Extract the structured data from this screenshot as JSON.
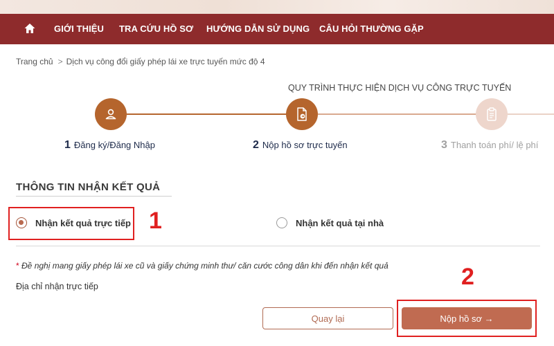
{
  "colors": {
    "brand": "#8e2b2c",
    "accent": "#c06b51",
    "step_active": "#b5652d",
    "step_inactive": "#eed6cc",
    "annotation": "#e02020"
  },
  "nav": {
    "home_icon": "home-icon",
    "items": [
      "GIỚI THIỆU",
      "TRA CỨU HỒ SƠ",
      "HƯỚNG DẪN SỬ DỤNG",
      "CÂU HỎI THƯỜNG GẶP"
    ]
  },
  "breadcrumb": {
    "home": "Trang chủ",
    "separator": ">",
    "current": "Dịch vụ công đổi giấy phép lái xe trực tuyến mức độ 4"
  },
  "process": {
    "title": "QUY TRÌNH THỰC HIỆN DỊCH VỤ CÔNG TRỰC TUYẾN",
    "steps": [
      {
        "number": "1",
        "label": "Đăng ký/Đăng Nhập",
        "icon": "user-icon",
        "state": "done"
      },
      {
        "number": "2",
        "label": "Nộp hồ sơ trực tuyến",
        "icon": "document-submit-icon",
        "state": "active"
      },
      {
        "number": "3",
        "label": "Thanh toán phí/ lệ phí",
        "icon": "clipboard-icon",
        "state": "pending"
      }
    ]
  },
  "result_section": {
    "title": "THÔNG TIN NHẬN KẾT QUẢ",
    "options": [
      {
        "label": "Nhận kết quả trực tiếp",
        "checked": true
      },
      {
        "label": "Nhận kết quả tại nhà",
        "checked": false
      }
    ],
    "note_star": "*",
    "note": "Đề nghị mang giấy phép lái xe cũ và giấy chứng minh thư/ căn cước công dân khi đến nhận kết quả",
    "address_label": "Địa chỉ nhận trực tiếp"
  },
  "annotations": [
    "1",
    "2"
  ],
  "buttons": {
    "back": "Quay lại",
    "submit": "Nộp hồ sơ →"
  }
}
